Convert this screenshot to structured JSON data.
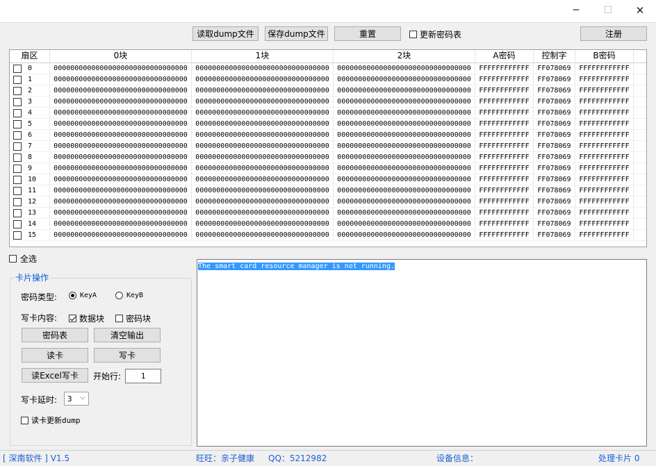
{
  "window": {
    "minimize": "─",
    "maximize": "☐",
    "close": "✕"
  },
  "toolbar": {
    "read_dump": "读取dump文件",
    "save_dump": "保存dump文件",
    "reset": "重置",
    "update_key_table": "更新密码表",
    "register": "注册"
  },
  "grid": {
    "columns": [
      "扇区",
      "0块",
      "1块",
      "2块",
      "A密码",
      "控制字",
      "B密码"
    ],
    "rows": [
      {
        "sector": "0",
        "b0": "00000000000000000000000000000000",
        "b1": "00000000000000000000000000000000",
        "b2": "00000000000000000000000000000000",
        "keyA": "FFFFFFFFFFFF",
        "access": "FF078069",
        "keyB": "FFFFFFFFFFFF"
      },
      {
        "sector": "1",
        "b0": "00000000000000000000000000000000",
        "b1": "00000000000000000000000000000000",
        "b2": "00000000000000000000000000000000",
        "keyA": "FFFFFFFFFFFF",
        "access": "FF078069",
        "keyB": "FFFFFFFFFFFF"
      },
      {
        "sector": "2",
        "b0": "00000000000000000000000000000000",
        "b1": "00000000000000000000000000000000",
        "b2": "00000000000000000000000000000000",
        "keyA": "FFFFFFFFFFFF",
        "access": "FF078069",
        "keyB": "FFFFFFFFFFFF"
      },
      {
        "sector": "3",
        "b0": "00000000000000000000000000000000",
        "b1": "00000000000000000000000000000000",
        "b2": "00000000000000000000000000000000",
        "keyA": "FFFFFFFFFFFF",
        "access": "FF078069",
        "keyB": "FFFFFFFFFFFF"
      },
      {
        "sector": "4",
        "b0": "00000000000000000000000000000000",
        "b1": "00000000000000000000000000000000",
        "b2": "00000000000000000000000000000000",
        "keyA": "FFFFFFFFFFFF",
        "access": "FF078069",
        "keyB": "FFFFFFFFFFFF"
      },
      {
        "sector": "5",
        "b0": "00000000000000000000000000000000",
        "b1": "00000000000000000000000000000000",
        "b2": "00000000000000000000000000000000",
        "keyA": "FFFFFFFFFFFF",
        "access": "FF078069",
        "keyB": "FFFFFFFFFFFF"
      },
      {
        "sector": "6",
        "b0": "00000000000000000000000000000000",
        "b1": "00000000000000000000000000000000",
        "b2": "00000000000000000000000000000000",
        "keyA": "FFFFFFFFFFFF",
        "access": "FF078069",
        "keyB": "FFFFFFFFFFFF"
      },
      {
        "sector": "7",
        "b0": "00000000000000000000000000000000",
        "b1": "00000000000000000000000000000000",
        "b2": "00000000000000000000000000000000",
        "keyA": "FFFFFFFFFFFF",
        "access": "FF078069",
        "keyB": "FFFFFFFFFFFF"
      },
      {
        "sector": "8",
        "b0": "00000000000000000000000000000000",
        "b1": "00000000000000000000000000000000",
        "b2": "00000000000000000000000000000000",
        "keyA": "FFFFFFFFFFFF",
        "access": "FF078069",
        "keyB": "FFFFFFFFFFFF"
      },
      {
        "sector": "9",
        "b0": "00000000000000000000000000000000",
        "b1": "00000000000000000000000000000000",
        "b2": "00000000000000000000000000000000",
        "keyA": "FFFFFFFFFFFF",
        "access": "FF078069",
        "keyB": "FFFFFFFFFFFF"
      },
      {
        "sector": "10",
        "b0": "00000000000000000000000000000000",
        "b1": "00000000000000000000000000000000",
        "b2": "00000000000000000000000000000000",
        "keyA": "FFFFFFFFFFFF",
        "access": "FF078069",
        "keyB": "FFFFFFFFFFFF"
      },
      {
        "sector": "11",
        "b0": "00000000000000000000000000000000",
        "b1": "00000000000000000000000000000000",
        "b2": "00000000000000000000000000000000",
        "keyA": "FFFFFFFFFFFF",
        "access": "FF078069",
        "keyB": "FFFFFFFFFFFF"
      },
      {
        "sector": "12",
        "b0": "00000000000000000000000000000000",
        "b1": "00000000000000000000000000000000",
        "b2": "00000000000000000000000000000000",
        "keyA": "FFFFFFFFFFFF",
        "access": "FF078069",
        "keyB": "FFFFFFFFFFFF"
      },
      {
        "sector": "13",
        "b0": "00000000000000000000000000000000",
        "b1": "00000000000000000000000000000000",
        "b2": "00000000000000000000000000000000",
        "keyA": "FFFFFFFFFFFF",
        "access": "FF078069",
        "keyB": "FFFFFFFFFFFF"
      },
      {
        "sector": "14",
        "b0": "00000000000000000000000000000000",
        "b1": "00000000000000000000000000000000",
        "b2": "00000000000000000000000000000000",
        "keyA": "FFFFFFFFFFFF",
        "access": "FF078069",
        "keyB": "FFFFFFFFFFFF"
      },
      {
        "sector": "15",
        "b0": "00000000000000000000000000000000",
        "b1": "00000000000000000000000000000000",
        "b2": "00000000000000000000000000000000",
        "keyA": "FFFFFFFFFFFF",
        "access": "FF078069",
        "keyB": "FFFFFFFFFFFF"
      }
    ]
  },
  "select_all": "全选",
  "card_ops": {
    "title": "卡片操作",
    "key_type_label": "密码类型:",
    "keyA": "KeyA",
    "keyB": "KeyB",
    "write_content_label": "写卡内容:",
    "data_block": "数据块",
    "key_block": "密码块",
    "key_table_btn": "密码表",
    "clear_output_btn": "清空输出",
    "read_card_btn": "读卡",
    "write_card_btn": "写卡",
    "read_excel_btn": "读Excel写卡",
    "start_row_label": "开始行:",
    "start_row_value": "1",
    "delay_label": "写卡延时:",
    "delay_value": "3",
    "update_dump": "读卡更新dump"
  },
  "output": {
    "text": "The smart card resource manager is not running."
  },
  "status": {
    "company": "[ 深南软件 ]  V1.5",
    "wangwang": "旺旺：亲子健康",
    "qq": "QQ：5212982",
    "device": "设备信息：",
    "processed": "处理卡片  0"
  },
  "colors": {
    "accent": "#1a5fd6",
    "selection": "#3399ff"
  }
}
